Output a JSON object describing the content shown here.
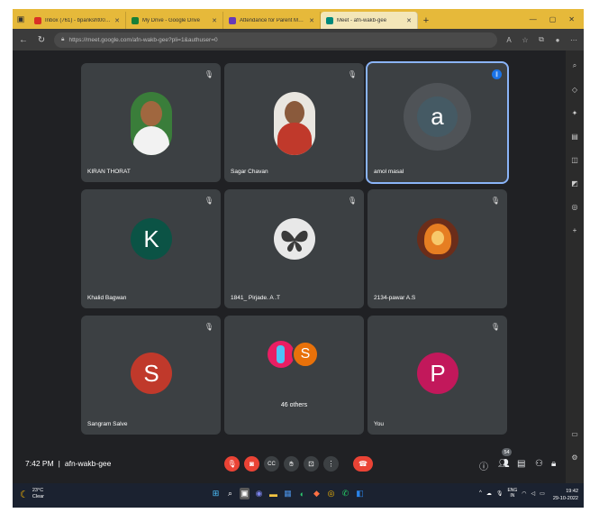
{
  "browser": {
    "tabs": [
      {
        "label": "Inbox (761) - bpanksht001@gmail",
        "favicon_color": "#d93025"
      },
      {
        "label": "My Drive - Google Drive",
        "favicon_color": "#188038"
      },
      {
        "label": "Attendance for Parent Meet 29",
        "favicon_color": "#673ab7"
      },
      {
        "label": "Meet - afn-wakb-gee",
        "favicon_color": "#00897b",
        "active": true
      }
    ],
    "new_tab": "+",
    "url": "https://meet.google.com/afn-wakb-gee?pli=1&authuser=0",
    "window_controls": {
      "minimize": "—",
      "maximize": "▢",
      "close": "✕"
    }
  },
  "participants": [
    {
      "name": "KIRAN THORAT",
      "type": "photo",
      "muted": true
    },
    {
      "name": "Sagar Chavan",
      "type": "photo",
      "muted": true
    },
    {
      "name": "amol masal",
      "type": "initial",
      "initial": "a",
      "color": "#455a64",
      "speaking": true
    },
    {
      "name": "Khalid Bagwan",
      "type": "initial",
      "initial": "K",
      "color": "#0b5345",
      "muted": true
    },
    {
      "name": "1841_ Pirjade. A .T",
      "type": "photo",
      "muted": true
    },
    {
      "name": "2134-pawar A.S",
      "type": "photo",
      "muted": true
    },
    {
      "name": "Sangram Salve",
      "type": "initial",
      "initial": "S",
      "color": "#c0392b",
      "muted": true
    },
    {
      "name": "46 others",
      "type": "group",
      "initial": "S",
      "color": "#e8710a"
    },
    {
      "name": "You",
      "type": "initial",
      "initial": "P",
      "color": "#c2185b",
      "muted": true
    }
  ],
  "meeting": {
    "time": "7:42 PM",
    "separator": "|",
    "code": "afn-wakb-gee",
    "participant_count": "54"
  },
  "taskbar": {
    "weather_temp": "23°C",
    "weather_desc": "Clear",
    "lang_line1": "ENG",
    "lang_line2": "IN",
    "clock_time": "19:42",
    "clock_date": "29-10-2022"
  }
}
